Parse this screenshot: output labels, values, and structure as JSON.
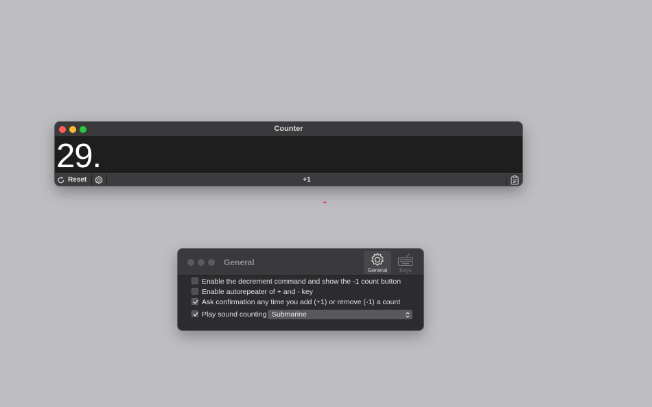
{
  "counter_window": {
    "title": "Counter",
    "value": "29.",
    "toolbar": {
      "reset_label": "Reset",
      "increment_label": "+1"
    }
  },
  "cursor": {
    "glyph": "+"
  },
  "preferences_window": {
    "title": "General",
    "tabs": [
      {
        "label": "General",
        "icon": "gear-icon",
        "selected": true
      },
      {
        "label": "Keys",
        "icon": "keyboard-icon",
        "selected": false
      }
    ],
    "options": [
      {
        "label": "Enable the decrement command and show the -1 count button",
        "checked": false
      },
      {
        "label": "Enable autorepeater of + and - key",
        "checked": false
      },
      {
        "label": "Ask confirmation any time you add (+1) or remove (-1) a count",
        "checked": true
      },
      {
        "label": "Play sound counting",
        "checked": true
      }
    ],
    "sound_select": {
      "value": "Submarine"
    }
  },
  "colors": {
    "desktop": "#bebec2",
    "close": "#fe5f57",
    "minimize": "#febc2e",
    "zoom": "#28c840",
    "cursor": "#e0306a"
  }
}
